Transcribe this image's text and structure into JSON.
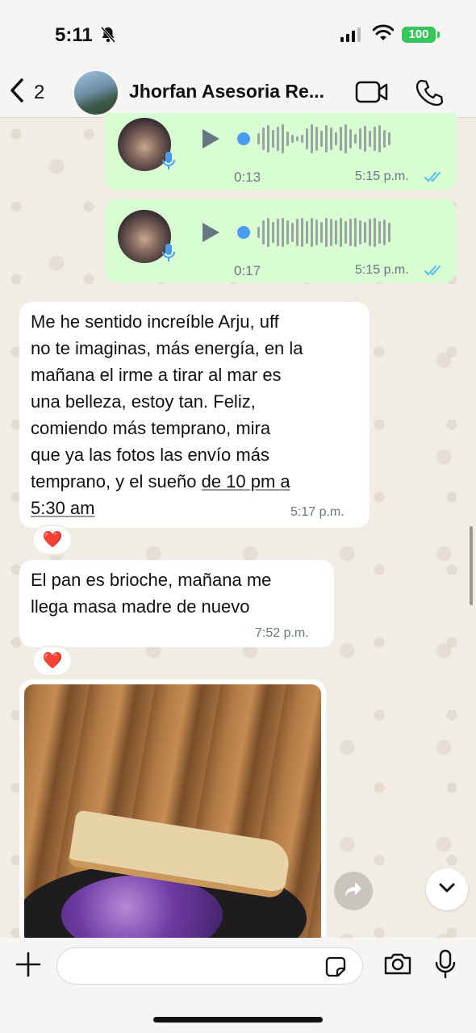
{
  "status_bar": {
    "time": "5:11",
    "battery": "100",
    "colors": {
      "battery": "#34c759"
    }
  },
  "header": {
    "back_count": "2",
    "contact_name": "Jhorfan Asesoria Re...",
    "icons": [
      "chevron-left-icon",
      "video-call-icon",
      "phone-icon"
    ]
  },
  "messages": [
    {
      "type": "audio",
      "direction": "outgoing",
      "duration": "0:13",
      "time": "5:15 p.m.",
      "status": "read"
    },
    {
      "type": "audio",
      "direction": "outgoing",
      "duration": "0:17",
      "time": "5:15 p.m.",
      "status": "read"
    },
    {
      "type": "text",
      "direction": "incoming",
      "lines": [
        "Me he sentido increíble Arju, uff",
        "no te imaginas, más energía, en la",
        "mañana el irme a tirar al mar es",
        "una belleza, estoy tan. Feliz,",
        "comiendo más temprano, mira",
        "que ya las fotos las envío más",
        "temprano, y el sueño",
        "de 10 pm a",
        "5:30 am"
      ],
      "time": "5:17 p.m.",
      "reaction": "❤️"
    },
    {
      "type": "text",
      "direction": "incoming",
      "lines": [
        "El pan es brioche, mañana me",
        "llega masa madre de nuevo"
      ],
      "time": "7:52 p.m.",
      "reaction": "❤️"
    },
    {
      "type": "image",
      "direction": "incoming",
      "description_icon": "photo-bread-icon"
    }
  ],
  "composer": {
    "placeholder": "",
    "value": ""
  },
  "colors": {
    "outgoing_bubble": "#d9fdd3",
    "incoming_bubble": "#ffffff",
    "read_ticks": "#53bdeb",
    "waveform_dot": "#4a9cf0"
  }
}
